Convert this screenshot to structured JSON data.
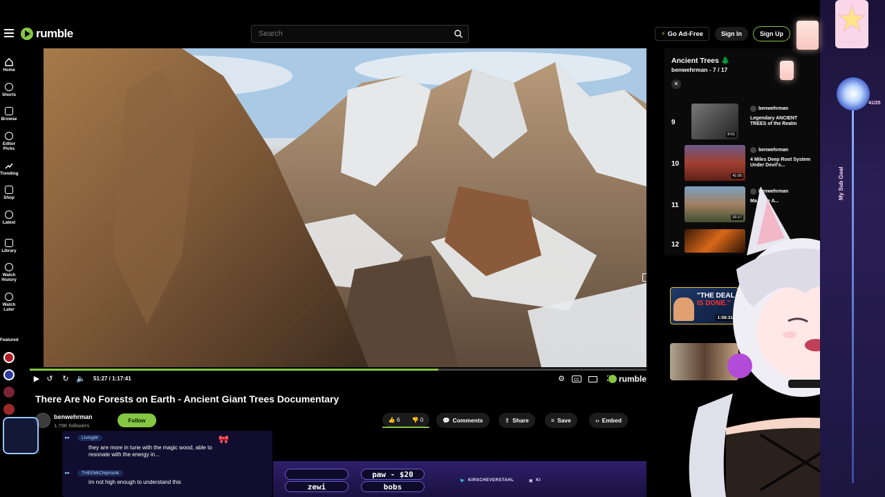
{
  "header": {
    "logo": "rumble",
    "search_placeholder": "Search",
    "go_ad_free": "Go Ad-Free",
    "sign_in": "Sign In",
    "sign_up": "Sign Up"
  },
  "nav": {
    "items": [
      {
        "label": "Home"
      },
      {
        "label": "Shorts"
      },
      {
        "label": "Browse"
      },
      {
        "label": "Editor Picks"
      },
      {
        "label": "Trending"
      },
      {
        "label": "Shop"
      },
      {
        "label": "Latest"
      },
      {
        "label": "Library"
      },
      {
        "label": "Watch History"
      },
      {
        "label": "Watch Later"
      }
    ],
    "featured_label": "Featured"
  },
  "player": {
    "timecode": "51:27 / 1:17:41",
    "progress": 0.662,
    "brand": "rumble"
  },
  "video": {
    "title": "There Are No Forests on Earth - Ancient Giant Trees Documentary",
    "channel": "benwehrman",
    "followers": "1.79K followers",
    "follow_label": "Follow",
    "likes": "6",
    "dislikes": "0",
    "actions": {
      "comments": "Comments",
      "share": "Share",
      "save": "Save",
      "embed": "Embed"
    }
  },
  "playlist": {
    "title": "Ancient Trees 🌲",
    "channel": "benwehrman",
    "position": "- 7 / 17",
    "items": [
      {
        "num": "9",
        "channel": "benwehrman",
        "title": "Legendary ANCIENT TREES of the Realm",
        "duration": "8:51"
      },
      {
        "num": "10",
        "channel": "benwehrman",
        "title": "4 Miles Deep Root System Under Devil's...",
        "duration": "41:05"
      },
      {
        "num": "11",
        "channel": "benwehrman",
        "title": "Ma... Are A...",
        "duration": "16:17"
      },
      {
        "num": "12",
        "channel": "",
        "title": "",
        "duration": ""
      }
    ]
  },
  "recommended": [
    {
      "thumb_text_1": "\"THE DEAL",
      "thumb_text_2": "IS DONE.\"",
      "duration": "1:58:31"
    },
    {
      "duration": ""
    }
  ],
  "overlay": {
    "live": "LIVE!",
    "sub_goal": "My Sub Goal",
    "sub_count": "41/25",
    "chat": [
      {
        "user": "LIvIngW",
        "message": "they are more in tune with the magic wood, able to resonate with the energy in..."
      },
      {
        "user": "THEEMrChipmunk",
        "message": "im not high enough to understand this"
      }
    ],
    "donations": [
      "paw - $20",
      "zewi",
      "bobs"
    ],
    "socials": [
      "KIRSCHEVERSTAHL",
      "KI"
    ]
  },
  "colors": {
    "accent": "#85c742",
    "background": "#000000",
    "overlay_purple": "#2d1e6a"
  }
}
